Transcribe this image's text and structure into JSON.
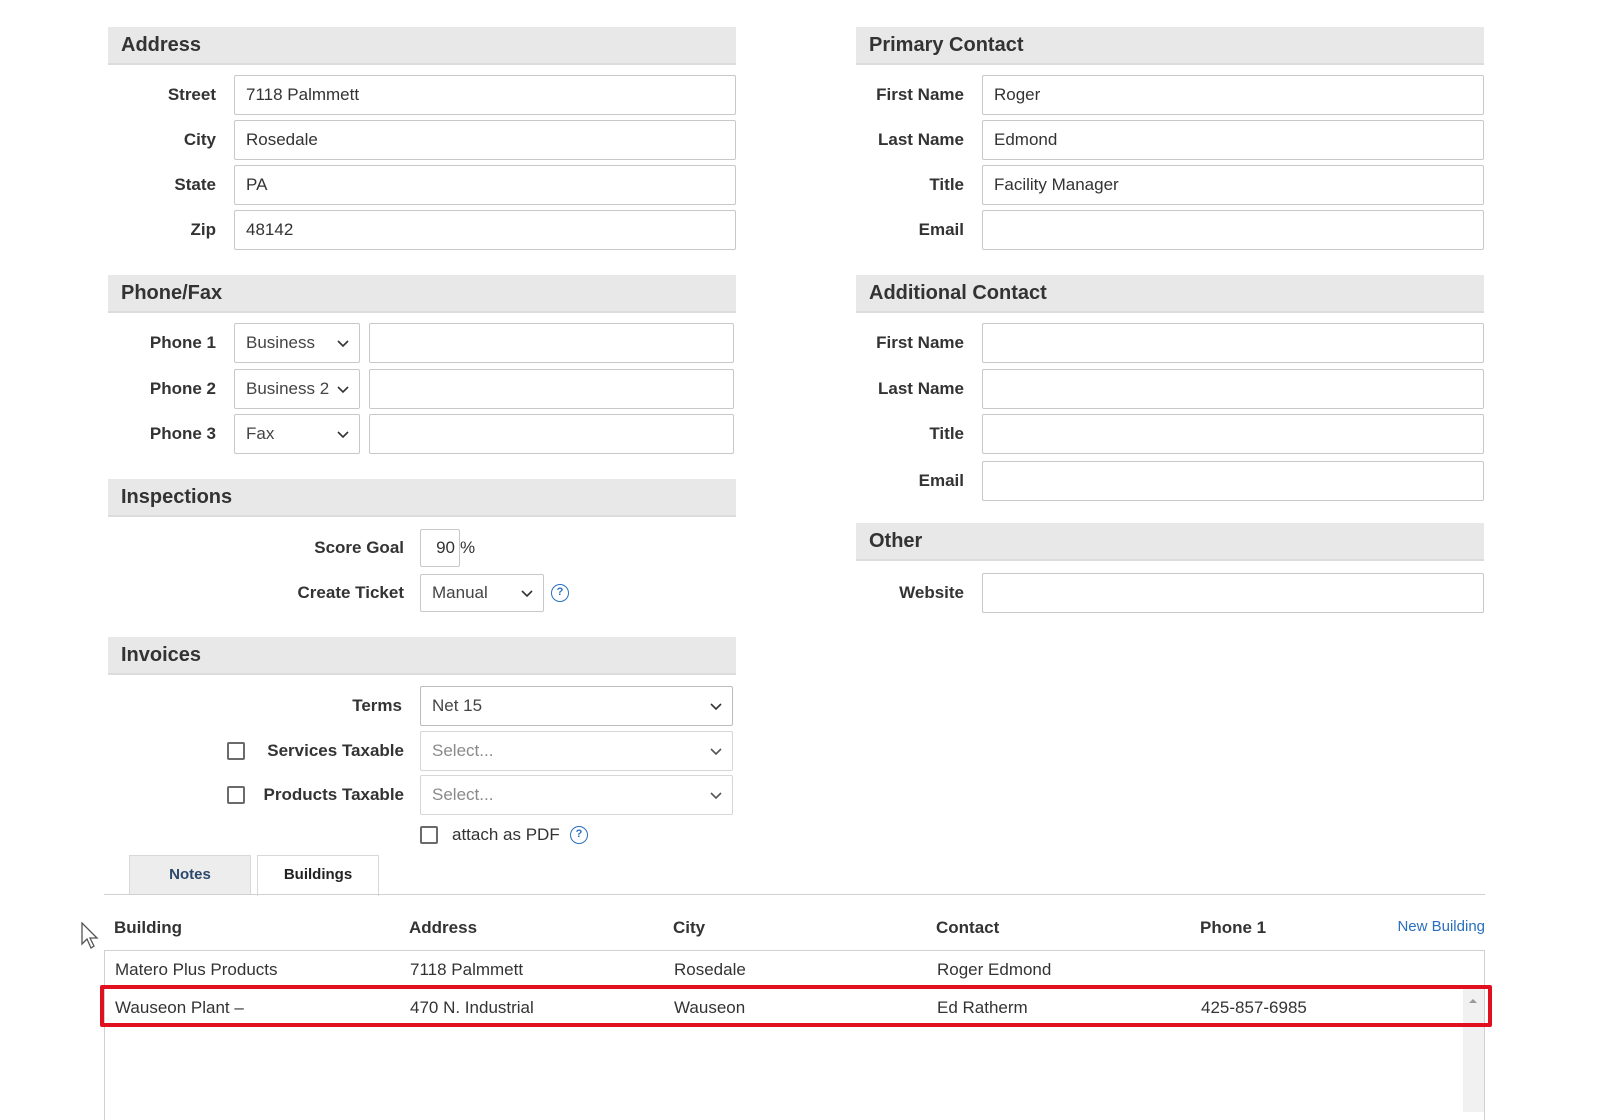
{
  "address": {
    "title": "Address",
    "street_label": "Street",
    "street_value": "7118 Palmmett",
    "city_label": "City",
    "city_value": "Rosedale",
    "state_label": "State",
    "state_value": "PA",
    "zip_label": "Zip",
    "zip_value": "48142"
  },
  "primary_contact": {
    "title": "Primary Contact",
    "first_name_label": "First Name",
    "first_name_value": "Roger",
    "last_name_label": "Last Name",
    "last_name_value": "Edmond",
    "title_label": "Title",
    "title_value": "Facility Manager",
    "email_label": "Email",
    "email_value": ""
  },
  "phone_fax": {
    "title": "Phone/Fax",
    "phone1_label": "Phone 1",
    "phone1_type": "Business",
    "phone1_value": "",
    "phone2_label": "Phone 2",
    "phone2_type": "Business 2",
    "phone2_value": "",
    "phone3_label": "Phone 3",
    "phone3_type": "Fax",
    "phone3_value": ""
  },
  "additional_contact": {
    "title": "Additional Contact",
    "first_name_label": "First Name",
    "first_name_value": "",
    "last_name_label": "Last Name",
    "last_name_value": "",
    "title_label": "Title",
    "title_value": "",
    "email_label": "Email",
    "email_value": ""
  },
  "inspections": {
    "title": "Inspections",
    "score_goal_label": "Score Goal",
    "score_goal_value": "90",
    "score_goal_unit": "%",
    "create_ticket_label": "Create Ticket",
    "create_ticket_value": "Manual",
    "help_glyph": "?"
  },
  "other": {
    "title": "Other",
    "website_label": "Website",
    "website_value": ""
  },
  "invoices": {
    "title": "Invoices",
    "terms_label": "Terms",
    "terms_value": "Net 15",
    "services_taxable_label": "Services Taxable",
    "services_taxable_placeholder": "Select...",
    "services_taxable_checked": false,
    "products_taxable_label": "Products Taxable",
    "products_taxable_placeholder": "Select...",
    "products_taxable_checked": false,
    "attach_pdf_label": "attach as PDF",
    "attach_pdf_checked": false,
    "help_glyph": "?"
  },
  "tabs": {
    "notes": "Notes",
    "buildings": "Buildings",
    "active": "Buildings"
  },
  "buildings": {
    "columns": [
      "Building",
      "Address",
      "City",
      "Contact",
      "Phone 1"
    ],
    "new_building_label": "New Building",
    "rows": [
      [
        "Matero Plus Products",
        "7118 Palmmett",
        "Rosedale",
        "Roger Edmond",
        ""
      ],
      [
        "Wauseon Plant –",
        "470 N. Industrial",
        "Wauseon",
        "Ed Ratherm",
        "425-857-6985"
      ]
    ],
    "highlighted_row": 1
  },
  "colors": {
    "section_header_bg": "#e8e8e8",
    "highlight_border": "#e0101e",
    "link_blue": "#2a6fbd",
    "notes_tab_text": "#2c4a6b"
  },
  "icons": {
    "chevron": "chevron-down-icon",
    "help": "help-circle-icon",
    "cursor": "mouse-pointer-icon",
    "scroll_up": "scroll-up-arrow-icon"
  }
}
